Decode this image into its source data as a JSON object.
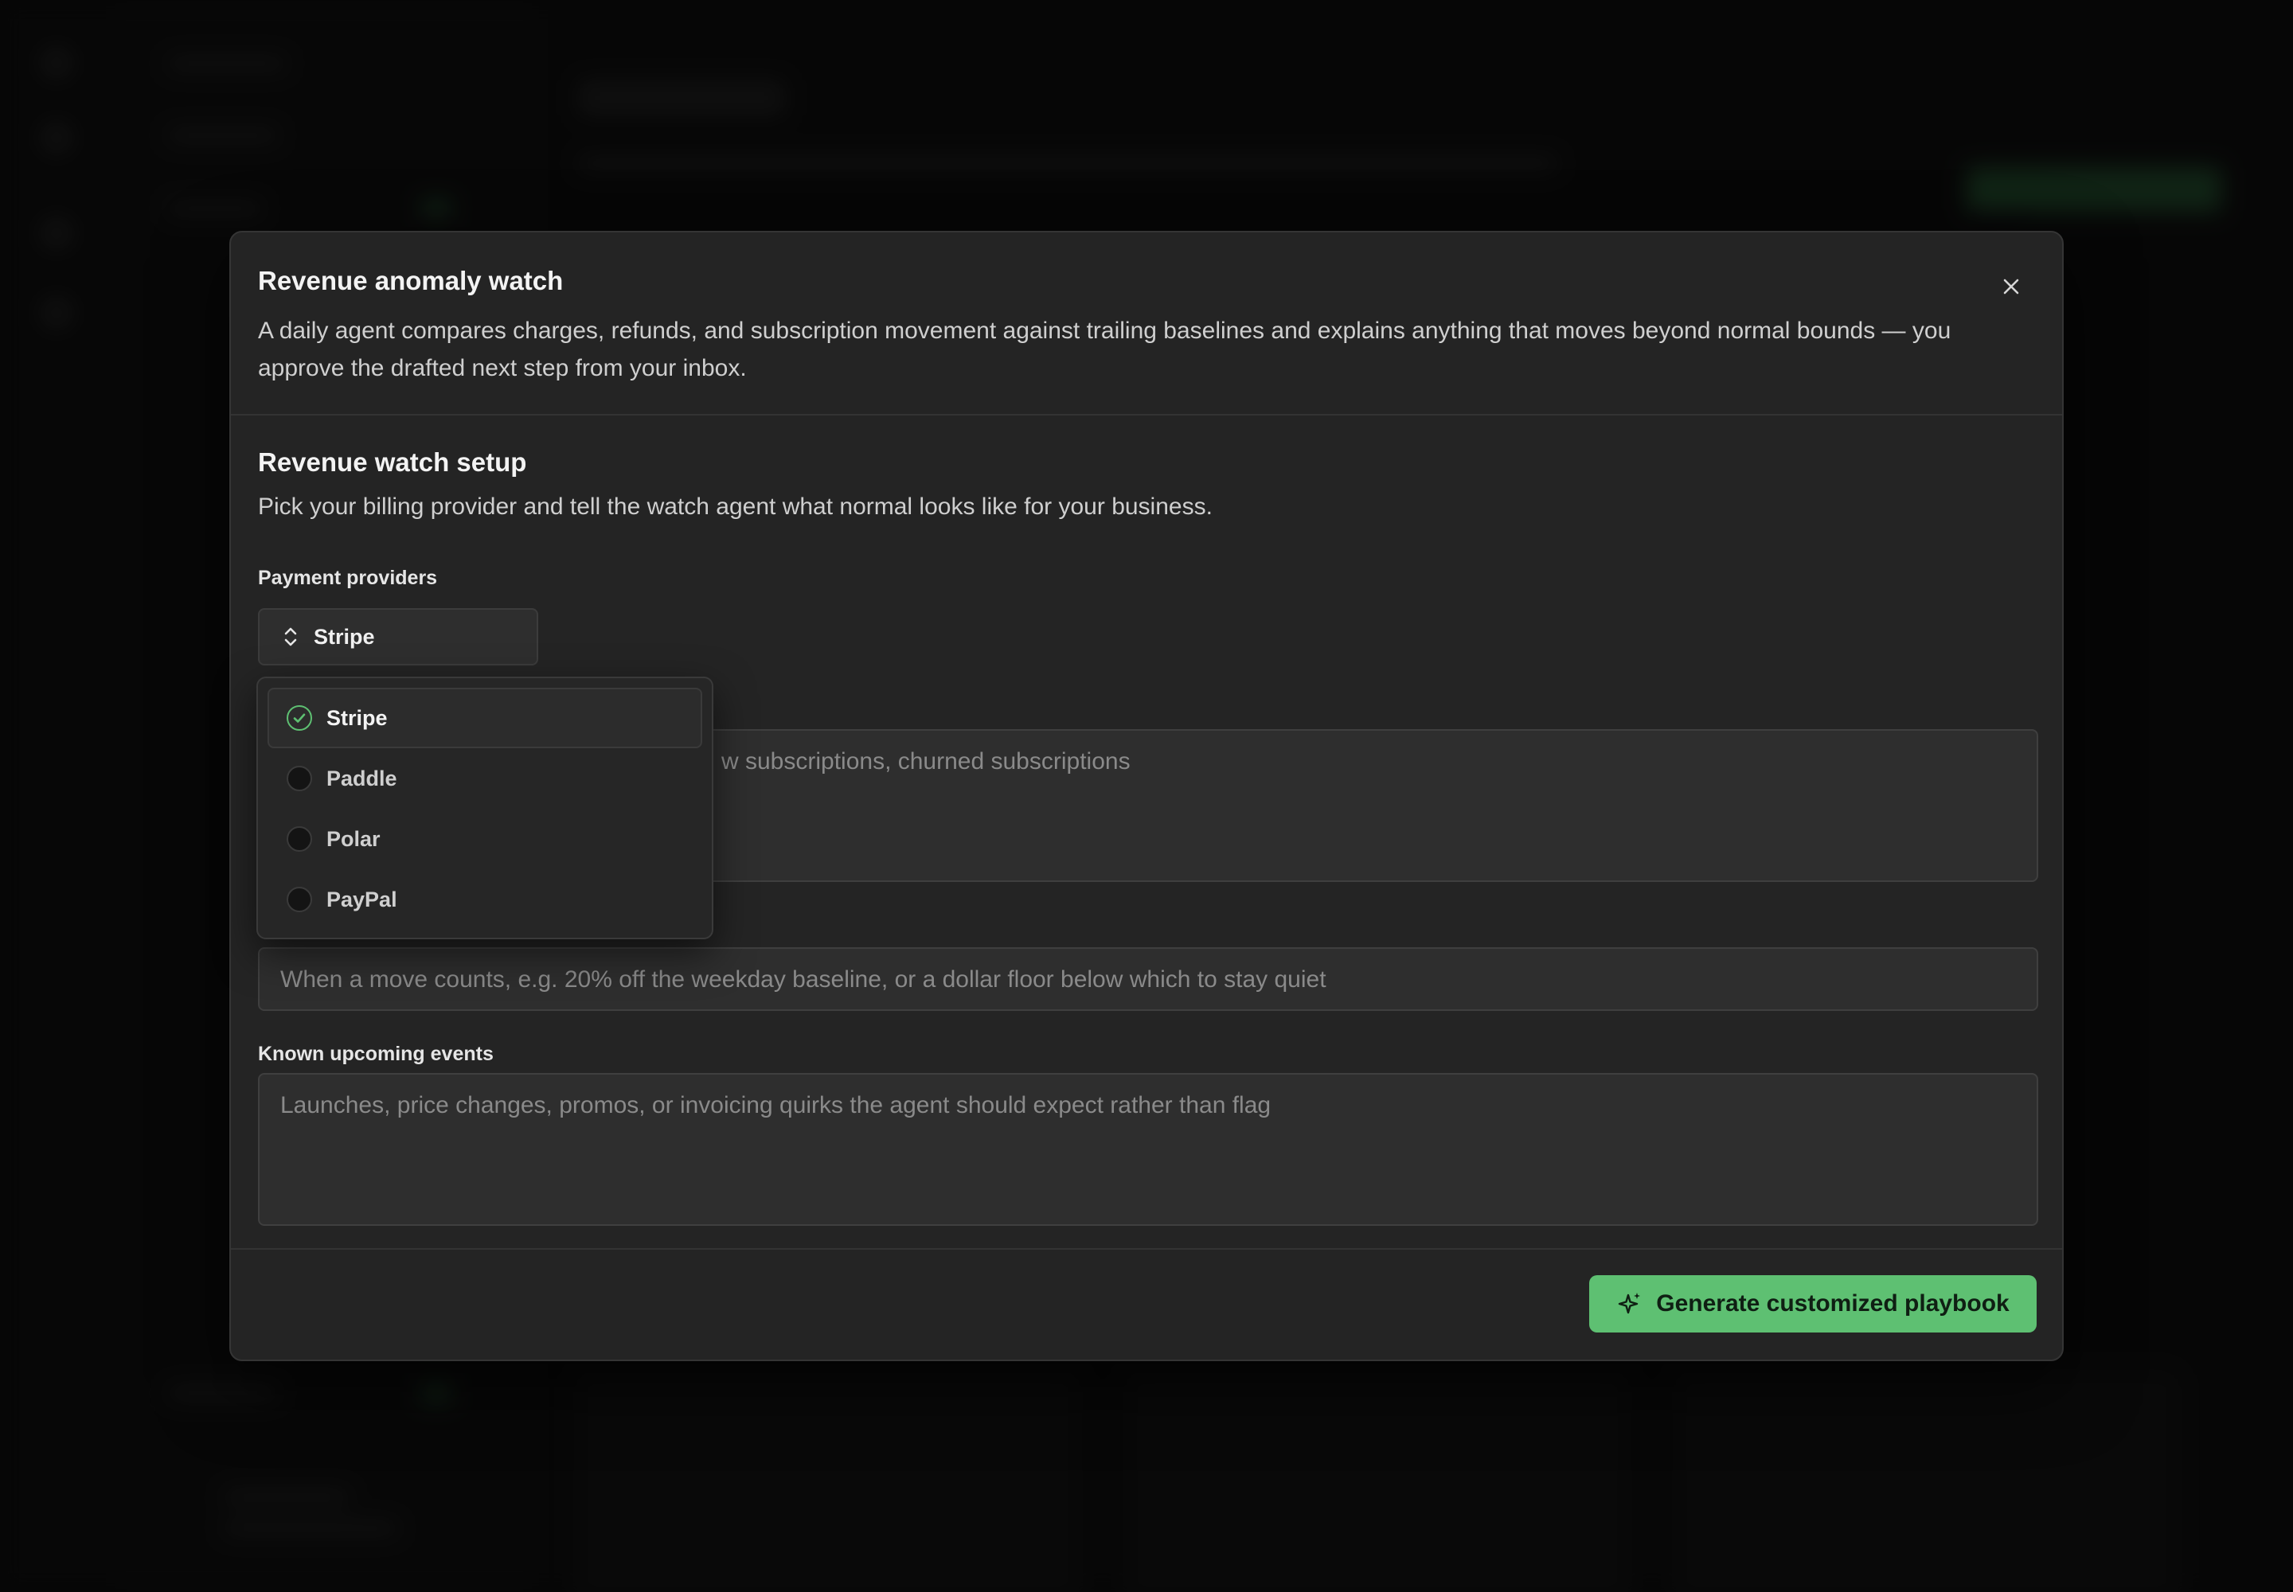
{
  "modal": {
    "title": "Revenue anomaly watch",
    "description": "A daily agent compares charges, refunds, and subscription movement against trailing baselines and explains anything that moves beyond normal bounds — you approve the drafted next step from your inbox.",
    "close_icon": "close-icon"
  },
  "setup": {
    "title": "Revenue watch setup",
    "description": "Pick your billing provider and tell the watch agent what normal looks like for your business."
  },
  "providers": {
    "label": "Payment providers",
    "selected": "Stripe",
    "options": [
      {
        "label": "Stripe",
        "checked": true
      },
      {
        "label": "Paddle",
        "checked": false
      },
      {
        "label": "Polar",
        "checked": false
      },
      {
        "label": "PayPal",
        "checked": false
      }
    ]
  },
  "metrics": {
    "placeholder_visible": "w subscriptions, churned subscriptions"
  },
  "thresholds": {
    "placeholder": "When a move counts, e.g. 20% off the weekday baseline, or a dollar floor below which to stay quiet"
  },
  "events": {
    "label": "Known upcoming events",
    "placeholder": "Launches, price changes, promos, or invoicing quirks the agent should expect rather than flag"
  },
  "footer": {
    "generate_label": "Generate customized playbook",
    "generate_icon": "sparkles-icon"
  },
  "colors": {
    "accent": "#5ec072",
    "modal_bg": "#242424",
    "backdrop": "#0b0b0b"
  }
}
